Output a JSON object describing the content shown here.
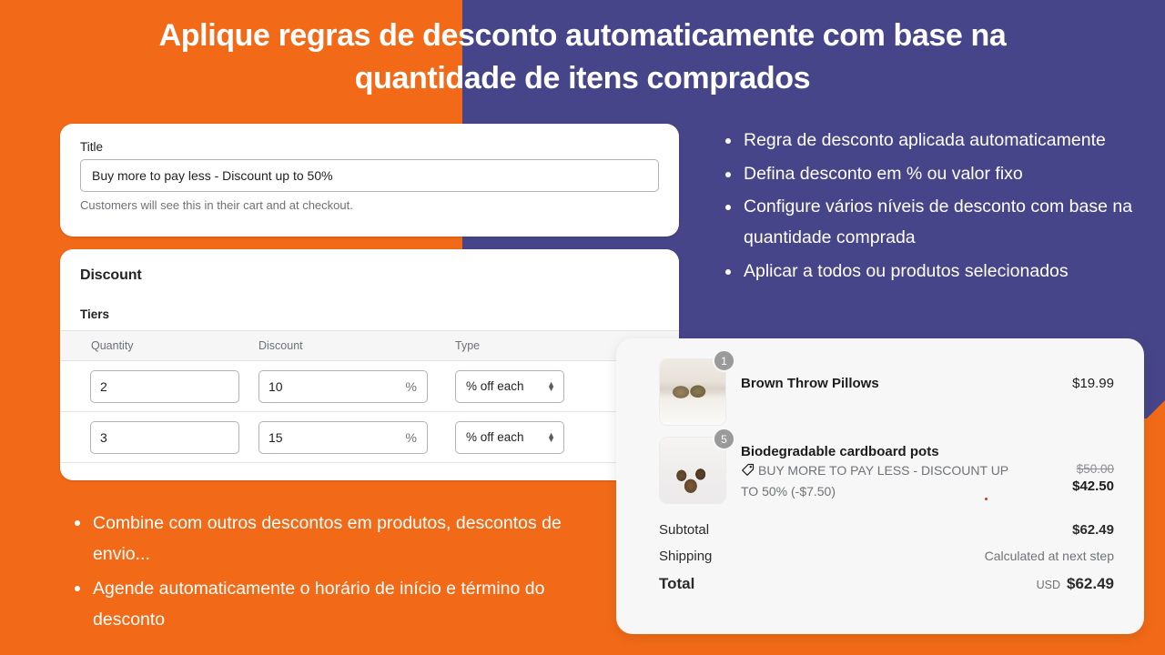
{
  "theme": {
    "orange": "#F26A17",
    "purple": "#474589",
    "white": "#FFFFFF",
    "card_bg": "#FFFFFF",
    "cart_bg": "#F7F7F7"
  },
  "headline": "Aplique regras de desconto automaticamente com base na quantidade de itens comprados",
  "admin": {
    "title_card": {
      "label": "Title",
      "value": "Buy more to pay less - Discount up to 50%",
      "help": "Customers will see this in their cart and at checkout."
    },
    "discount_card": {
      "heading": "Discount",
      "subheading": "Tiers",
      "columns": [
        "Quantity",
        "Discount",
        "Type"
      ],
      "rows": [
        {
          "quantity": "2",
          "discount": "10",
          "suffix": "%",
          "type": "% off each"
        },
        {
          "quantity": "3",
          "discount": "15",
          "suffix": "%",
          "type": "% off each"
        }
      ]
    }
  },
  "bullets_right": [
    "Regra de desconto aplicada automaticamente",
    "Defina desconto em % ou valor fixo",
    "Configure vários níveis de desconto com base na quantidade comprada",
    "Aplicar a todos ou produtos selecionados"
  ],
  "bullets_bottom": [
    "Combine com outros descontos em produtos, descontos de envio...",
    "Agende automaticamente o horário de início e término do desconto"
  ],
  "cart": {
    "items": [
      {
        "qty": "1",
        "name": "Brown Throw Pillows",
        "discount_note": "",
        "price": "$19.99",
        "price_old": "",
        "price_new": "",
        "thumb": "brown-throw-pillows-photo"
      },
      {
        "qty": "5",
        "name": "Biodegradable cardboard pots",
        "discount_note": "BUY MORE TO PAY LESS - DISCOUNT UP TO 50% (-$7.50)",
        "price": "",
        "price_old": "$50.00",
        "price_new": "$42.50",
        "thumb": "cardboard-pots-photo"
      }
    ],
    "totals": {
      "subtotal_label": "Subtotal",
      "subtotal_value": "$62.49",
      "shipping_label": "Shipping",
      "shipping_value": "Calculated at next step",
      "total_label": "Total",
      "total_currency": "USD",
      "total_value": "$62.49"
    }
  }
}
